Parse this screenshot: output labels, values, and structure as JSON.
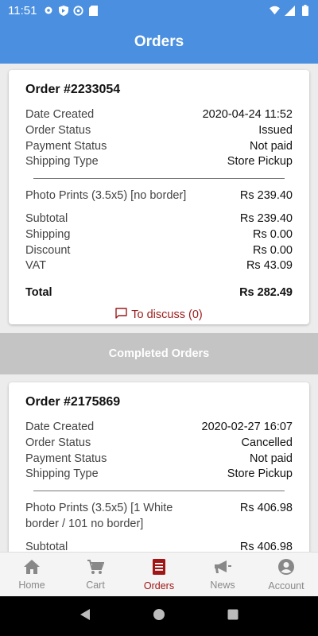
{
  "status_bar": {
    "time": "11:51",
    "icons_left": [
      "gear-icon",
      "shield-icon",
      "at-icon",
      "sd-card-icon"
    ],
    "icons_right": [
      "wifi-icon",
      "signal-icon",
      "battery-icon"
    ]
  },
  "app_bar": {
    "title": "Orders"
  },
  "current_order": {
    "title": "Order #2233054",
    "info": [
      {
        "label": "Date Created",
        "value": "2020-04-24 11:52"
      },
      {
        "label": "Order Status",
        "value": "Issued"
      },
      {
        "label": "Payment Status",
        "value": "Not paid"
      },
      {
        "label": "Shipping Type",
        "value": "Store Pickup"
      }
    ],
    "items": [
      {
        "label": "Photo Prints (3.5x5) [no border]",
        "value": "Rs 239.40"
      }
    ],
    "totals": [
      {
        "label": "Subtotal",
        "value": "Rs 239.40"
      },
      {
        "label": "Shipping",
        "value": "Rs 0.00"
      },
      {
        "label": "Discount",
        "value": "Rs 0.00"
      },
      {
        "label": "VAT",
        "value": "Rs 43.09"
      }
    ],
    "total": {
      "label": "Total",
      "value": "Rs 282.49"
    },
    "discuss_label": "To discuss (0)"
  },
  "completed_section": {
    "title": "Completed Orders"
  },
  "completed_order": {
    "title": "Order #2175869",
    "info": [
      {
        "label": "Date Created",
        "value": "2020-02-27 16:07"
      },
      {
        "label": "Order Status",
        "value": "Cancelled"
      },
      {
        "label": "Payment Status",
        "value": "Not paid"
      },
      {
        "label": "Shipping Type",
        "value": "Store Pickup"
      }
    ],
    "items": [
      {
        "label": "Photo Prints (3.5x5) [1 White border / 101 no border]",
        "value": "Rs 406.98"
      }
    ],
    "totals": [
      {
        "label": "Subtotal",
        "value": "Rs 406.98"
      }
    ]
  },
  "bottom_nav": {
    "items": [
      {
        "label": "Home",
        "icon": "home-icon",
        "active": false
      },
      {
        "label": "Cart",
        "icon": "cart-icon",
        "active": false
      },
      {
        "label": "Orders",
        "icon": "orders-icon",
        "active": true
      },
      {
        "label": "News",
        "icon": "megaphone-icon",
        "active": false
      },
      {
        "label": "Account",
        "icon": "account-icon",
        "active": false
      }
    ]
  },
  "colors": {
    "primary": "#4a8fe0",
    "accent": "#a01515",
    "section_header": "#c4c4c4"
  }
}
